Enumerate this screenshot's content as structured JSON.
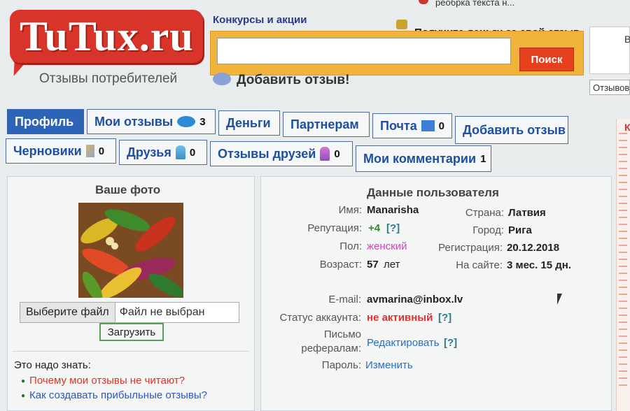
{
  "header": {
    "top_link": "реобрка текста н...",
    "logo": "TuTux.ru",
    "tagline": "Отзывы потребителей",
    "contests": "Конкурсы и акции",
    "money": "Получите деньги за свой отзыв",
    "search_value": "",
    "search_button": "Поиск",
    "add_review": "Добавить отзыв!",
    "right_letter": "В",
    "right_reviews": "Отзывов"
  },
  "tabs_row1": [
    {
      "label": "Профиль"
    },
    {
      "label": "Мои отзывы",
      "count": "3"
    },
    {
      "label": "Деньги"
    },
    {
      "label": "Партнерам"
    },
    {
      "label": "Почта",
      "count": "0"
    },
    {
      "label": "Добавить отзыв"
    }
  ],
  "tabs_row2": [
    {
      "label": "Черновики",
      "count": "0"
    },
    {
      "label": "Друзья",
      "count": "0"
    },
    {
      "label": "Отзывы друзей",
      "count": "0"
    },
    {
      "label": "Мои комментарии",
      "count": "1"
    }
  ],
  "photo": {
    "title": "Ваше фото",
    "file_button": "Выберите файл",
    "file_status": "Файл не выбран",
    "upload": "Загрузить"
  },
  "know": {
    "title": "Это надо знать:",
    "items": [
      "Почему мои отзывы не читают?",
      "Как создавать прибыльные отзывы?"
    ]
  },
  "user": {
    "title": "Данные пользователя",
    "name_label": "Имя:",
    "name": "Manarisha",
    "rep_label": "Репутация:",
    "rep": "+4",
    "help": "[?]",
    "sex_label": "Пол:",
    "sex": "женский",
    "age_label": "Возраст:",
    "age": "57",
    "age_unit": "лет",
    "country_label": "Страна:",
    "country": "Латвия",
    "city_label": "Город:",
    "city": "Рига",
    "reg_label": "Регистрация:",
    "reg": "20.12.2018",
    "onsite_label": "На сайте:",
    "onsite": "3 мес. 15 дн.",
    "email_label": "E-mail:",
    "email": "avmarina@inbox.lv",
    "status_label": "Статус аккаунта:",
    "status": "не активный",
    "letter_label_1": "Письмо",
    "letter_label_2": "рефералам:",
    "letter": "Редактировать",
    "pass_label": "Пароль:",
    "pass": "Изменить"
  },
  "edge": {
    "mark": "К"
  }
}
